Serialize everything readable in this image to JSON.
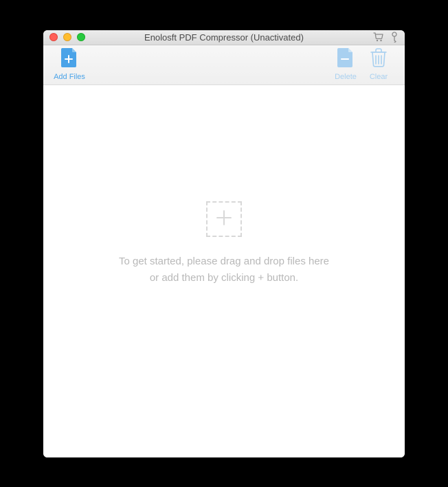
{
  "window": {
    "title": "Enolosft PDF Compressor (Unactivated)"
  },
  "toolbar": {
    "add_files_label": "Add Files",
    "delete_label": "Delete",
    "clear_label": "Clear"
  },
  "empty_state": {
    "line1": "To get started, please drag and drop files here",
    "line2": "or add them by clicking + button."
  },
  "colors": {
    "accent": "#4aa3e8",
    "accent_faded": "#a8d0f0"
  }
}
